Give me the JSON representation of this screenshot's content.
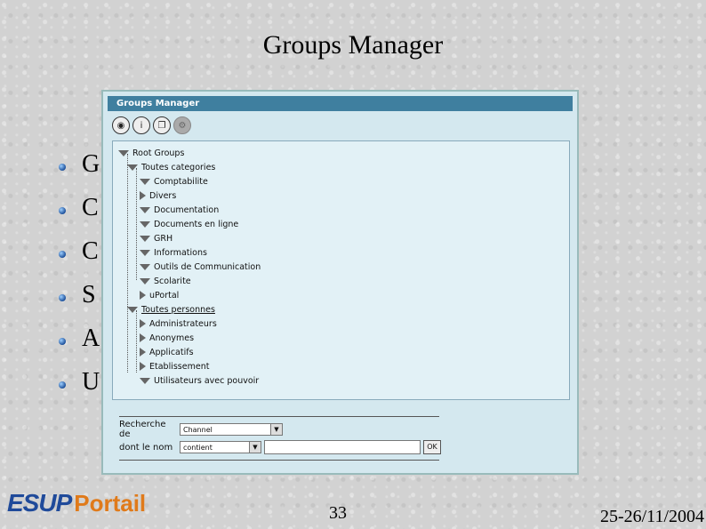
{
  "slide": {
    "title": "Groups Manager",
    "bullets": [
      "G",
      "C",
      "C",
      "S",
      "A",
      "U"
    ],
    "page_number": "33",
    "date": "25-26/11/2004"
  },
  "logo": {
    "part1": "ESUP",
    "part2": "Portail"
  },
  "window": {
    "title": "Groups Manager",
    "toolbar": [
      {
        "icon": "eye-icon",
        "glyph": "◉"
      },
      {
        "icon": "info-icon",
        "glyph": "i"
      },
      {
        "icon": "windows-icon",
        "glyph": "❐"
      },
      {
        "icon": "gear-icon",
        "glyph": "⚙"
      }
    ],
    "tree": {
      "root": "Root Groups",
      "categories_label": "Toutes categories",
      "categories": [
        {
          "label": "Comptabilite",
          "expanded": true
        },
        {
          "label": "Divers",
          "expanded": false
        },
        {
          "label": "Documentation",
          "expanded": true
        },
        {
          "label": "Documents en ligne",
          "expanded": true
        },
        {
          "label": "GRH",
          "expanded": true
        },
        {
          "label": "Informations",
          "expanded": true
        },
        {
          "label": "Outils de Communication",
          "expanded": true
        },
        {
          "label": "Scolarite",
          "expanded": true
        },
        {
          "label": "uPortal",
          "expanded": false
        }
      ],
      "persons_label": "Toutes personnes",
      "persons": [
        {
          "label": "Administrateurs",
          "expanded": false
        },
        {
          "label": "Anonymes",
          "expanded": false
        },
        {
          "label": "Applicatifs",
          "expanded": false
        },
        {
          "label": "Etablissement",
          "expanded": false
        },
        {
          "label": "Utilisateurs avec pouvoir",
          "expanded": true
        }
      ]
    },
    "search": {
      "type_label": "Recherche de",
      "type_value": "Channel",
      "name_label": "dont le nom",
      "op_value": "contient",
      "query_value": "",
      "ok_label": "OK"
    }
  },
  "colors": {
    "titlebar": "#3f7f9f",
    "panel": "#d4e8ef",
    "logo_blue": "#1f4a9a",
    "logo_orange": "#e07a1a"
  }
}
